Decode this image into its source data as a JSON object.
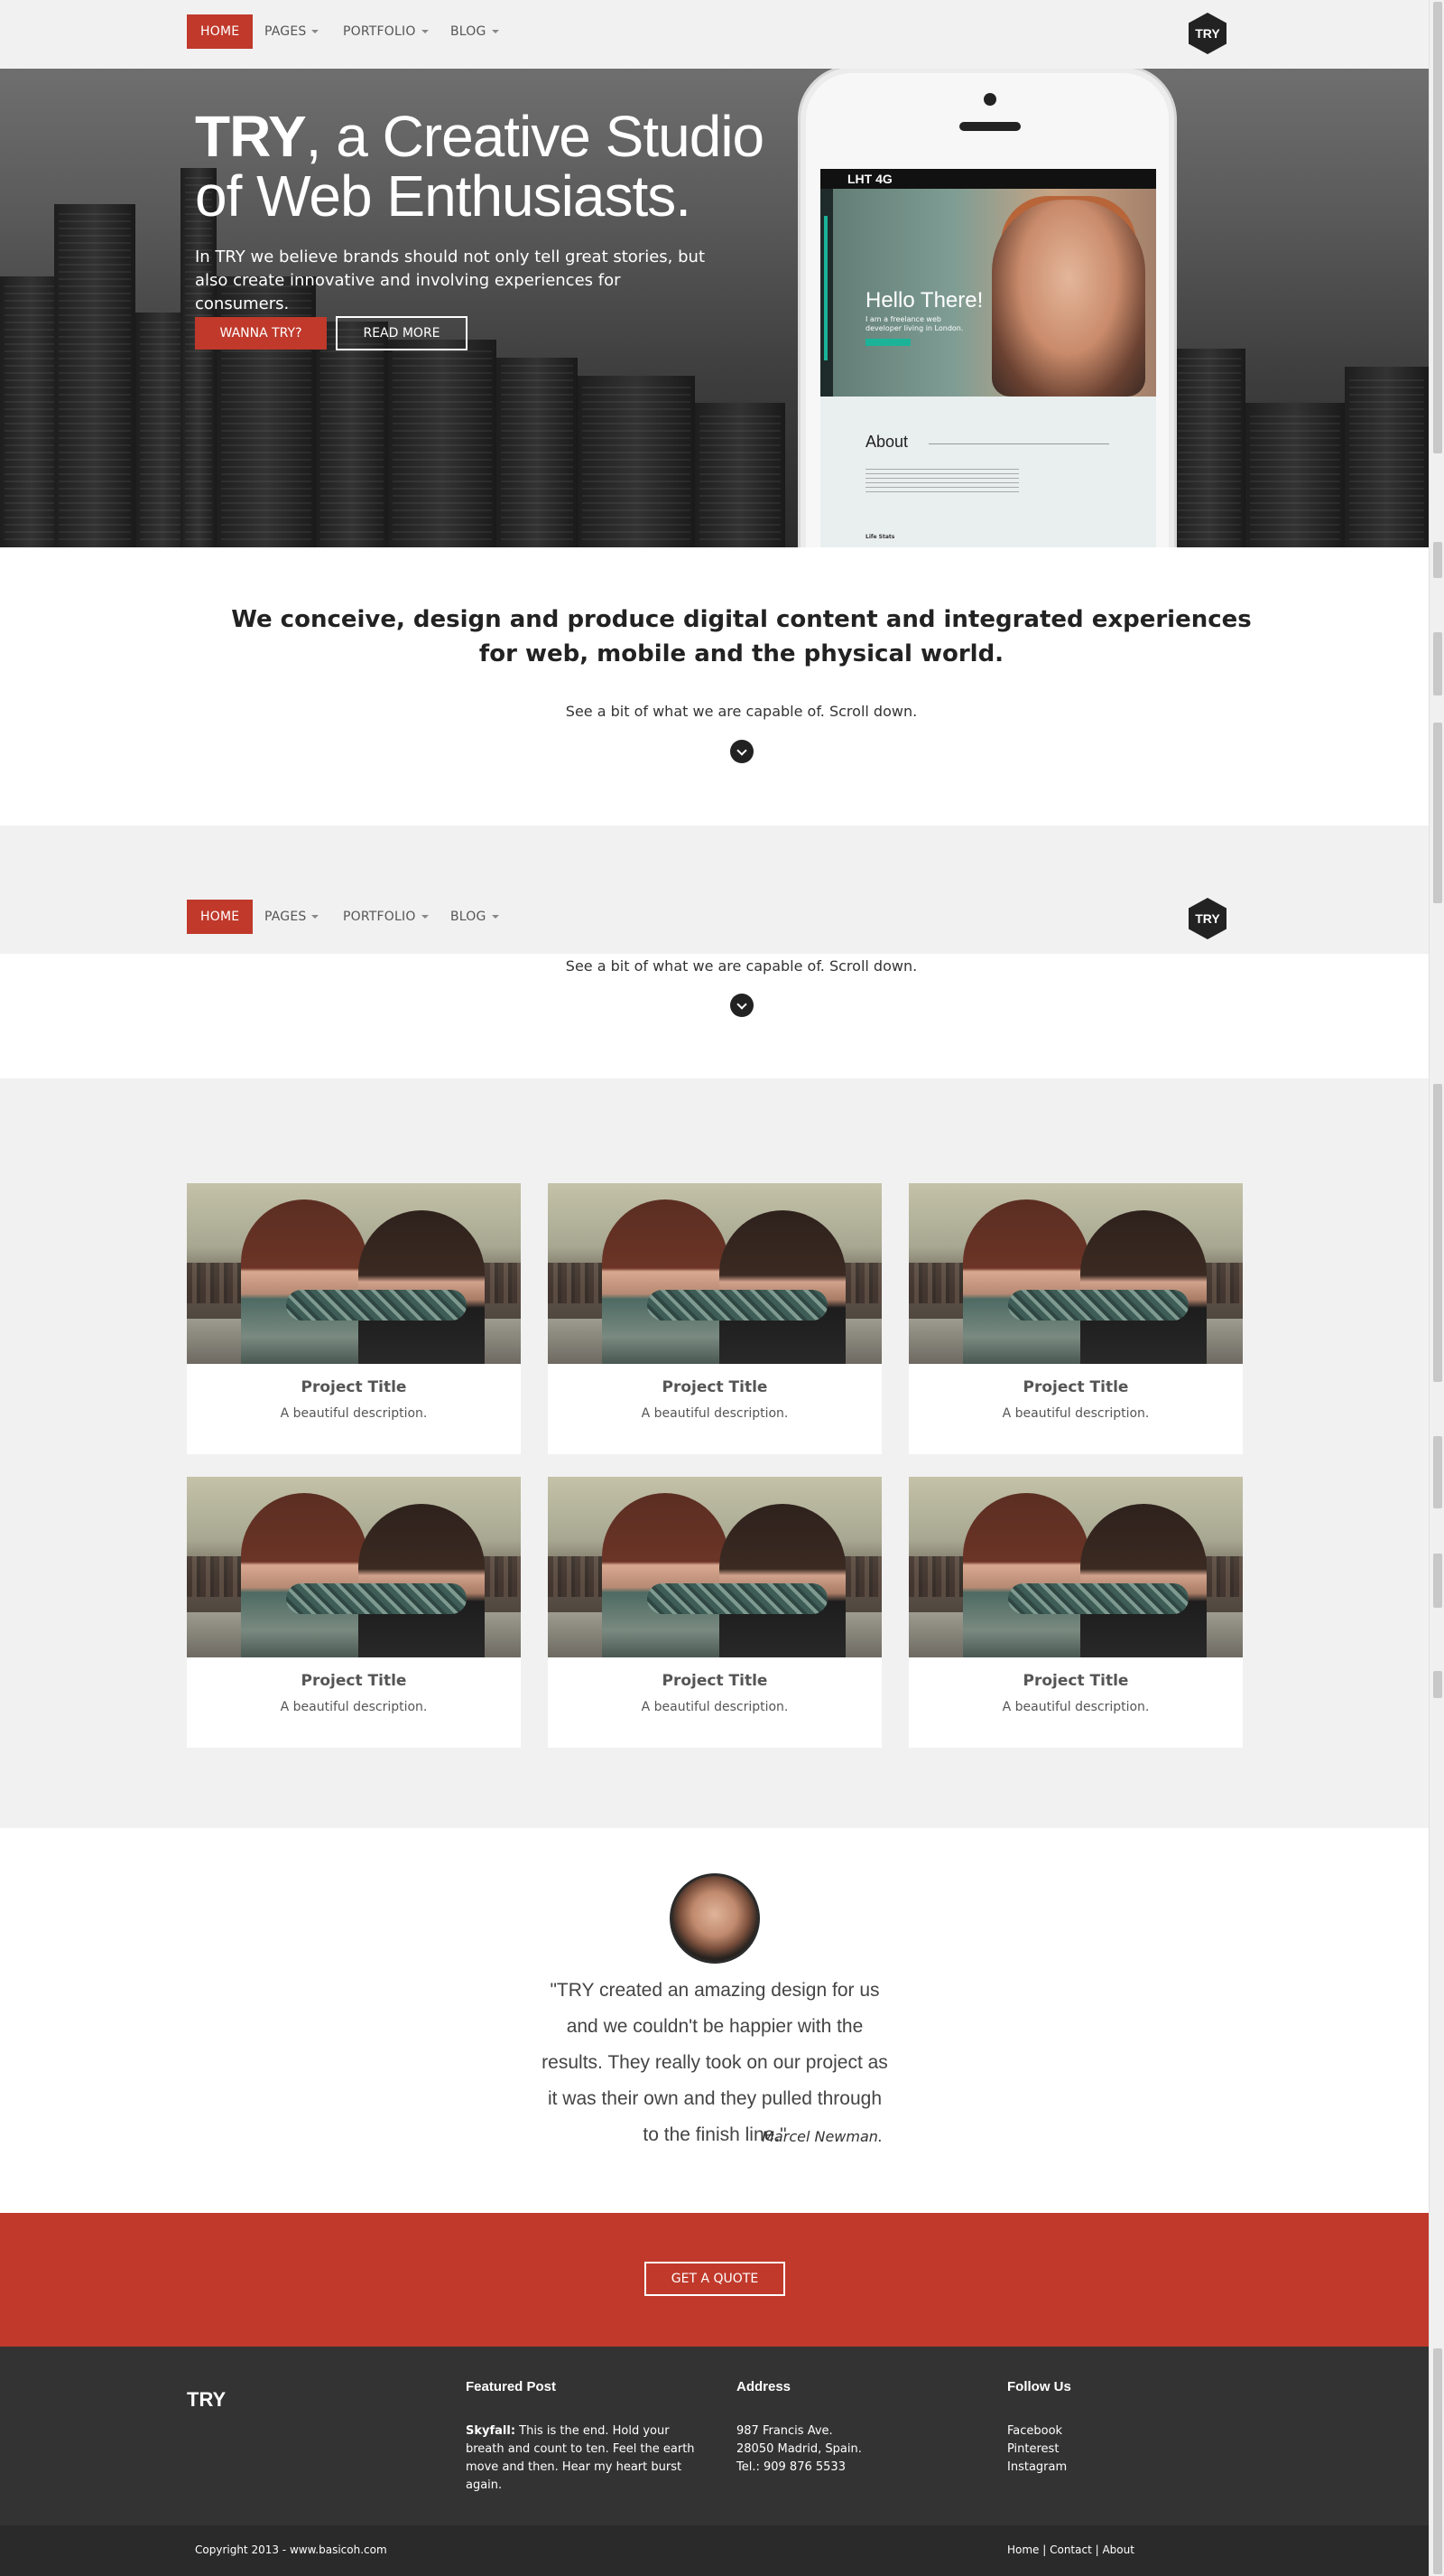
{
  "nav": {
    "home": "HOME",
    "pages": "PAGES",
    "portfolio": "PORTFOLIO",
    "blog": "BLOG",
    "logo": "TRY"
  },
  "hero": {
    "title_bold": "TRY",
    "title_rest_1": ", a Creative Studio",
    "title_line_2": "of Web Enthusiasts.",
    "subtitle": "In TRY we believe brands should not only tell great stories, but also create innovative and involving experiences for consumers.",
    "btn_primary": "WANNA TRY?",
    "btn_secondary": "READ MORE"
  },
  "phone": {
    "status": "LHT 4G",
    "hello": "Hello There!",
    "hello_sub": "I am a freelance web developer living in London.",
    "about": "About",
    "life_stats": "Life Stats"
  },
  "intro": {
    "heading": "We conceive, design and produce digital content and integrated experiences for web, mobile and the physical world.",
    "sub": "See a bit of what we are capable of. Scroll down."
  },
  "portfolio": {
    "cards": [
      {
        "title": "Project Title",
        "desc": "A beautiful description."
      },
      {
        "title": "Project Title",
        "desc": "A beautiful description."
      },
      {
        "title": "Project Title",
        "desc": "A beautiful description."
      },
      {
        "title": "Project Title",
        "desc": "A beautiful description."
      },
      {
        "title": "Project Title",
        "desc": "A beautiful description."
      },
      {
        "title": "Project Title",
        "desc": "A beautiful description."
      }
    ]
  },
  "testimonial": {
    "quote": "\"TRY created an amazing design for us and we couldn't be happier with the results. They really took on our project as it was their own and they pulled through to the finish line.\"",
    "author": "Marcel Newman."
  },
  "cta": {
    "label": "GET A QUOTE"
  },
  "footer": {
    "brand": "TRY",
    "featured_title": "Featured Post",
    "featured_bold": "Skyfall:",
    "featured_text": " This is the end. Hold your breath and count to ten. Feel the earth move and then. Hear my heart burst again.",
    "address_title": "Address",
    "address_1": "987 Francis Ave.",
    "address_2": "28050 Madrid, Spain.",
    "address_3": "Tel.: 909 876 5533",
    "follow_title": "Follow Us",
    "follow_1": "Facebook",
    "follow_2": "Pinterest",
    "follow_3": "Instagram",
    "copyright": "Copyright 2013 - www.basicoh.com",
    "links": {
      "home": "Home",
      "sep": " | ",
      "contact": "Contact",
      "about": "About"
    }
  },
  "colors": {
    "accent": "#c0392b",
    "dark": "#333333",
    "nav_bg": "#f1f1f1"
  }
}
